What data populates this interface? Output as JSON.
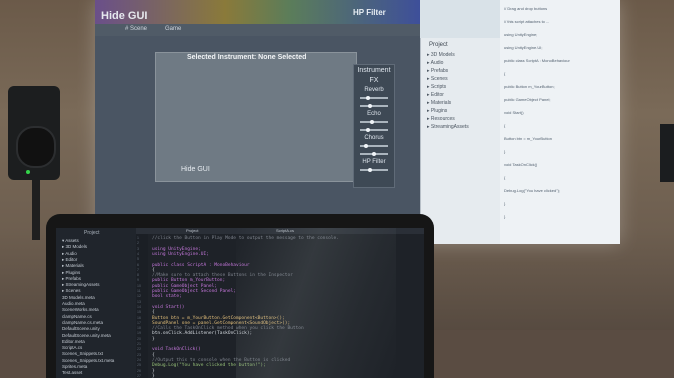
{
  "projector": {
    "game_view": {
      "hide_gui_top": "Hide GUI",
      "hp_filter": "HP Filter",
      "tabs": [
        "# Scene",
        "Game"
      ],
      "selected_instrument": "Selected Instrument: None Selected",
      "instrument_heading": "Instrument",
      "fx_heading": "FX",
      "fx_labels": [
        "Reverb",
        "Echo",
        "Chorus",
        "HP Filter"
      ],
      "hide_gui_bottom": "Hide GUI"
    },
    "project_panel": {
      "title": "Project",
      "items": [
        "▸ 3D Models",
        "▸ Audio",
        "▸ Prefabs",
        "▸ Scenes",
        "▸ Scripts",
        "▸ Editor",
        "▸ Materials",
        "▸ Plugins",
        "▸ Resources",
        "▸ StreamingAssets"
      ]
    },
    "code_lines": [
      "// Drag and drop buttons",
      "// this script attaches to ...",
      "using UnityEngine;",
      "using UnityEngine.UI;",
      "public class ScriptA : MonoBehaviour",
      "{",
      "  public Button m_YourButton;",
      "  public GameObject Panel;",
      "  void Start()",
      "  {",
      "    Button btn = m_YourButton",
      "  }",
      "  void TaskOnClick()",
      "  {",
      "    Debug.Log(\"You have clicked\");",
      "  }",
      "}"
    ]
  },
  "laptop": {
    "sidebar_title": "Project",
    "file_tree": [
      "▾ Assets",
      "  ▸ 3D Models",
      "  ▸ Audio",
      "  ▸ Editor",
      "  ▸ Materials",
      "  ▸ Plugins",
      "  ▸ Prefabs",
      "  ▸ StreamingAssets",
      "  ▸ Scenes",
      "    3D Models.meta",
      "    Audio.meta",
      "    SceneWorks.meta",
      "    clampName.cs",
      "    clampName.cs.meta",
      "    DefaultScene.unity",
      "    DefaultScene.unity.meta",
      "    Editor.meta",
      "    ScriptA.cs",
      "    Scenes_Snippets.txt",
      "    Scenes_Snippets.txt.meta",
      "    Sprites.meta",
      "    Test.asset"
    ],
    "tabs": [
      "Project",
      "ScriptA.cs"
    ],
    "code": [
      "//click the Button in Play Mode to output the message to the console.",
      "",
      "using UnityEngine;",
      "using UnityEngine.UI;",
      "",
      "public class ScriptA : MonoBehaviour",
      "{",
      "    //Make sure to attach these Buttons in the Inspector",
      "    public Button m_YourButton;",
      "    public GameObject Panel;",
      "    public GameObject Second Panel;",
      "    bool state;",
      "",
      "    void Start()",
      "    {",
      "        Button btn = m_YourButton.GetComponent<Button>();",
      "        SoundPanel one = panel.GetComponent<SoundObject>();",
      "        //Calls the TaskOnClick method when you click the Button",
      "        btn.onClick.AddListener(TaskOnClick);",
      "    }",
      "",
      "    void TaskOnClick()",
      "    {",
      "        //Output this to console when the Button is clicked",
      "        Debug.Log(\"You have clicked the button!\");",
      "    }",
      "}"
    ]
  },
  "colors": {
    "keyword": "#c678dd",
    "type": "#e5c07b",
    "string": "#98c379",
    "comment": "#7f848e",
    "accent_led": "#34d44a"
  }
}
